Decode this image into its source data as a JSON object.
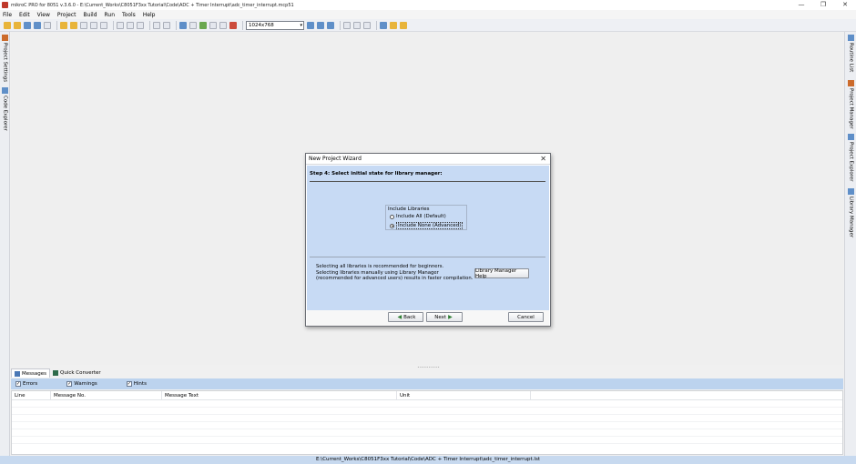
{
  "window": {
    "title": "mikroC PRO for 8051 v.3.6.0 - E:\\Current_Works\\C8051F3xx Tutorial\\Code\\ADC + Timer Interrupt\\adc_timer_interrupt.mcp51",
    "minimize": "—",
    "restore": "❐",
    "close": "✕"
  },
  "menu": [
    "File",
    "Edit",
    "View",
    "Project",
    "Build",
    "Run",
    "Tools",
    "Help"
  ],
  "toolbar": {
    "resolution": "1024x768"
  },
  "left_tabs": [
    "Project Settings",
    "Code Explorer"
  ],
  "right_tabs": [
    "Routine List",
    "Project Manager",
    "Project Explorer",
    "Library Manager"
  ],
  "dialog": {
    "title": "New Project Wizard",
    "close": "✕",
    "step": "Step 4: Select initial state for library manager:",
    "group_label": "Include Libraries",
    "options": [
      {
        "label": "Include All (Default)",
        "selected": false
      },
      {
        "label": "Include None (Advanced)",
        "selected": true
      }
    ],
    "info_lines": [
      "Selecting all libraries is recommended for beginners.",
      "Selecting libraries manually using Library Manager",
      "(recommended for advanced users) results in faster compilation."
    ],
    "help_button": "Library Manager Help",
    "back_button": "Back",
    "next_button": "Next",
    "cancel_button": "Cancel"
  },
  "bottom_panel": {
    "tabs": [
      "Messages",
      "Quick Converter"
    ],
    "filters": [
      {
        "label": "Errors",
        "checked": true
      },
      {
        "label": "Warnings",
        "checked": true
      },
      {
        "label": "Hints",
        "checked": true
      }
    ],
    "columns": [
      "Line",
      "Message No.",
      "Message Text",
      "Unit"
    ]
  },
  "status": {
    "path": "E:\\Current_Works\\C8051F3xx Tutorial\\Code\\ADC + Timer Interrupt\\adc_timer_interrupt.lst"
  }
}
